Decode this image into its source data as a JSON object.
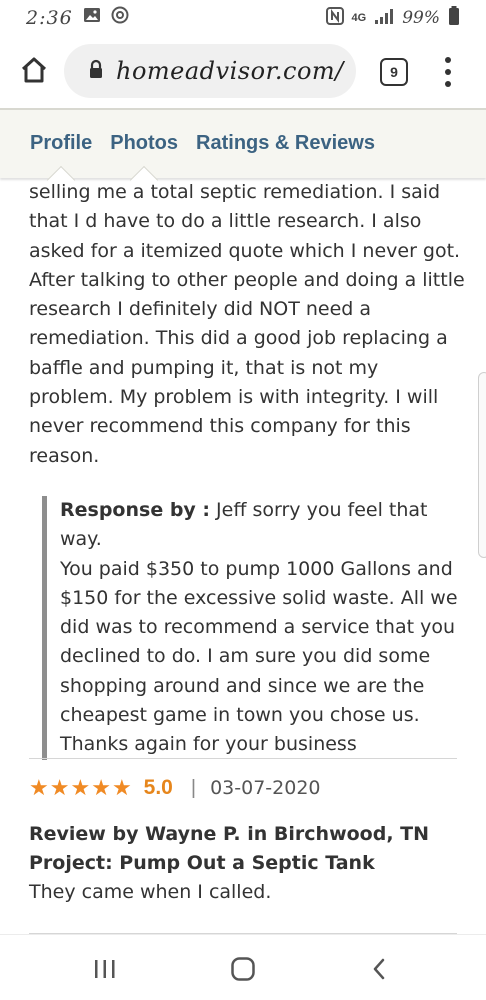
{
  "status_bar": {
    "time": "2:36",
    "network": "4G",
    "battery_percent": "99%",
    "icons": [
      "gallery-icon",
      "sync-icon",
      "nfc-icon",
      "signal-icon",
      "battery-icon"
    ]
  },
  "browser": {
    "url": "homeadvisor.com/",
    "tab_count": "9",
    "icons": [
      "home-icon",
      "lock-icon",
      "tabs-icon",
      "more-menu-icon"
    ]
  },
  "profile_tabs": [
    {
      "label": "Profile"
    },
    {
      "label": "Photos"
    },
    {
      "label": "Ratings & Reviews"
    }
  ],
  "review_text": [
    "selling me a total septic remediation. I said",
    "that I d have to do a little research. I also",
    "asked for a itemized quote which I never got.",
    "After talking to other people and doing a little",
    "research I definitely did NOT need a",
    "remediation. This did a good job replacing a",
    "baffle and pumping it, that is not my",
    "problem. My problem is with integrity. I will",
    "never recommend this company for this",
    "reason."
  ],
  "response": {
    "label": "Response by :",
    "first_line": " Jeff sorry you feel that way.",
    "lines": [
      "You paid $350 to pump 1000 Gallons and",
      "$150 for the excessive solid waste. All we",
      "did was to recommend a service that you",
      "declined to do. I am sure you did some",
      "shopping around and since we are the",
      "cheapest game in town you chose us.",
      "Thanks again for your business"
    ]
  },
  "next_review": {
    "stars": 5,
    "score": "5.0",
    "separator": "|",
    "date": "03-07-2020",
    "reviewer": "Review by Wayne P. in Birchwood, TN",
    "project": "Project: Pump Out a Septic Tank",
    "text": "They came when I called."
  },
  "colors": {
    "tab_text": "#3c6382",
    "star": "#f08a24",
    "score": "#e6861c",
    "response_bar": "#8e8e8e"
  },
  "nav_icons": [
    "recent-apps-icon",
    "home-nav-icon",
    "back-icon"
  ]
}
